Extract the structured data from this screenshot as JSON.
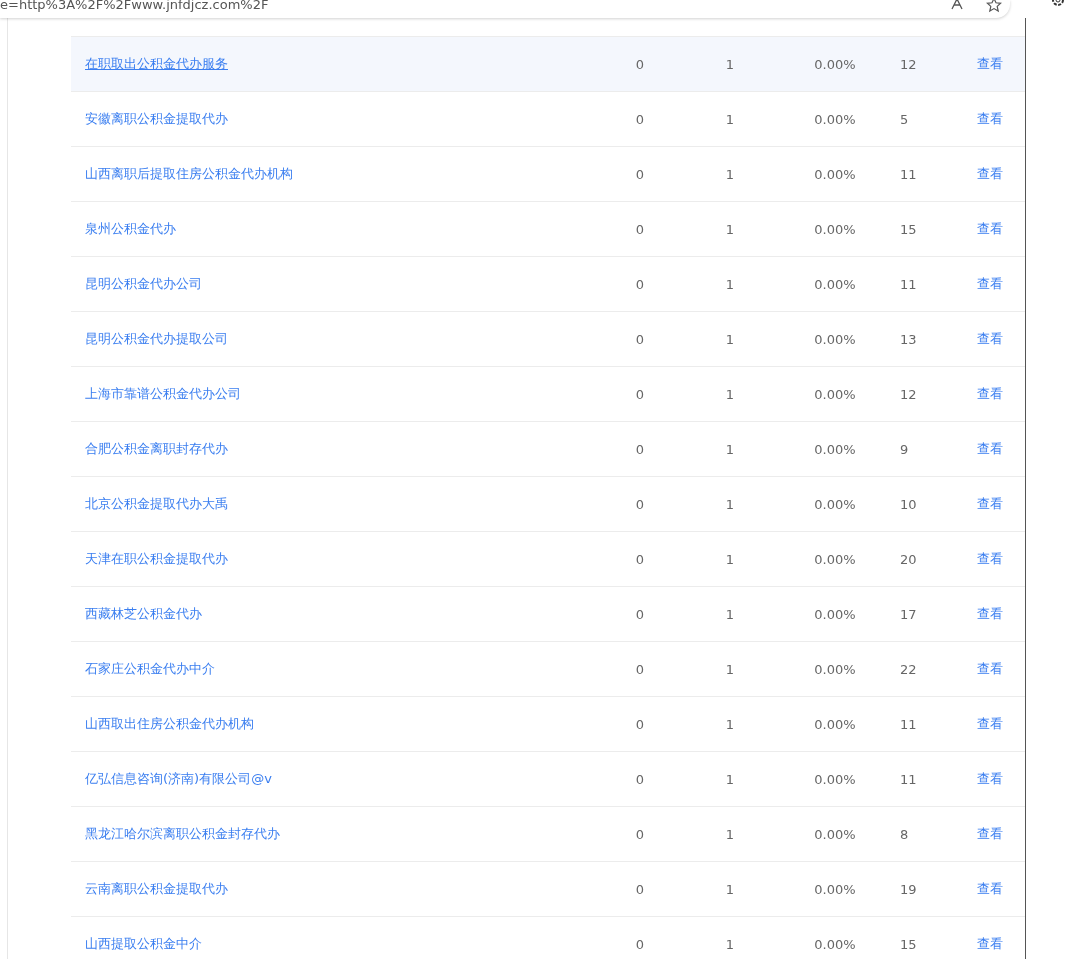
{
  "browser": {
    "address": "e=http%3A%2F%2Fwww.jnfdjcz.com%2F"
  },
  "table": {
    "rows": [
      {
        "name": "在职取出公积金代办服务",
        "column_2": "0",
        "column_3": "1",
        "column_4": "0.00%",
        "column_5": "12",
        "action": "查看",
        "highlighted": true
      },
      {
        "name": "安徽离职公积金提取代办",
        "column_2": "0",
        "column_3": "1",
        "column_4": "0.00%",
        "column_5": "5",
        "action": "查看",
        "highlighted": false
      },
      {
        "name": "山西离职后提取住房公积金代办机构",
        "column_2": "0",
        "column_3": "1",
        "column_4": "0.00%",
        "column_5": "11",
        "action": "查看",
        "highlighted": false
      },
      {
        "name": "泉州公积金代办",
        "column_2": "0",
        "column_3": "1",
        "column_4": "0.00%",
        "column_5": "15",
        "action": "查看",
        "highlighted": false
      },
      {
        "name": "昆明公积金代办公司",
        "column_2": "0",
        "column_3": "1",
        "column_4": "0.00%",
        "column_5": "11",
        "action": "查看",
        "highlighted": false
      },
      {
        "name": "昆明公积金代办提取公司",
        "column_2": "0",
        "column_3": "1",
        "column_4": "0.00%",
        "column_5": "13",
        "action": "查看",
        "highlighted": false
      },
      {
        "name": "上海市靠谱公积金代办公司",
        "column_2": "0",
        "column_3": "1",
        "column_4": "0.00%",
        "column_5": "12",
        "action": "查看",
        "highlighted": false
      },
      {
        "name": "合肥公积金离职封存代办",
        "column_2": "0",
        "column_3": "1",
        "column_4": "0.00%",
        "column_5": "9",
        "action": "查看",
        "highlighted": false
      },
      {
        "name": "北京公积金提取代办大禹",
        "column_2": "0",
        "column_3": "1",
        "column_4": "0.00%",
        "column_5": "10",
        "action": "查看",
        "highlighted": false
      },
      {
        "name": "天津在职公积金提取代办",
        "column_2": "0",
        "column_3": "1",
        "column_4": "0.00%",
        "column_5": "20",
        "action": "查看",
        "highlighted": false
      },
      {
        "name": "西藏林芝公积金代办",
        "column_2": "0",
        "column_3": "1",
        "column_4": "0.00%",
        "column_5": "17",
        "action": "查看",
        "highlighted": false
      },
      {
        "name": "石家庄公积金代办中介",
        "column_2": "0",
        "column_3": "1",
        "column_4": "0.00%",
        "column_5": "22",
        "action": "查看",
        "highlighted": false
      },
      {
        "name": "山西取出住房公积金代办机构",
        "column_2": "0",
        "column_3": "1",
        "column_4": "0.00%",
        "column_5": "11",
        "action": "查看",
        "highlighted": false
      },
      {
        "name": "亿弘信息咨询(济南)有限公司@v",
        "column_2": "0",
        "column_3": "1",
        "column_4": "0.00%",
        "column_5": "11",
        "action": "查看",
        "highlighted": false
      },
      {
        "name": "黑龙江哈尔滨离职公积金封存代办",
        "column_2": "0",
        "column_3": "1",
        "column_4": "0.00%",
        "column_5": "8",
        "action": "查看",
        "highlighted": false
      },
      {
        "name": "云南离职公积金提取代办",
        "column_2": "0",
        "column_3": "1",
        "column_4": "0.00%",
        "column_5": "19",
        "action": "查看",
        "highlighted": false
      },
      {
        "name": "山西提取公积金中介",
        "column_2": "0",
        "column_3": "1",
        "column_4": "0.00%",
        "column_5": "15",
        "action": "查看",
        "highlighted": false
      }
    ]
  }
}
